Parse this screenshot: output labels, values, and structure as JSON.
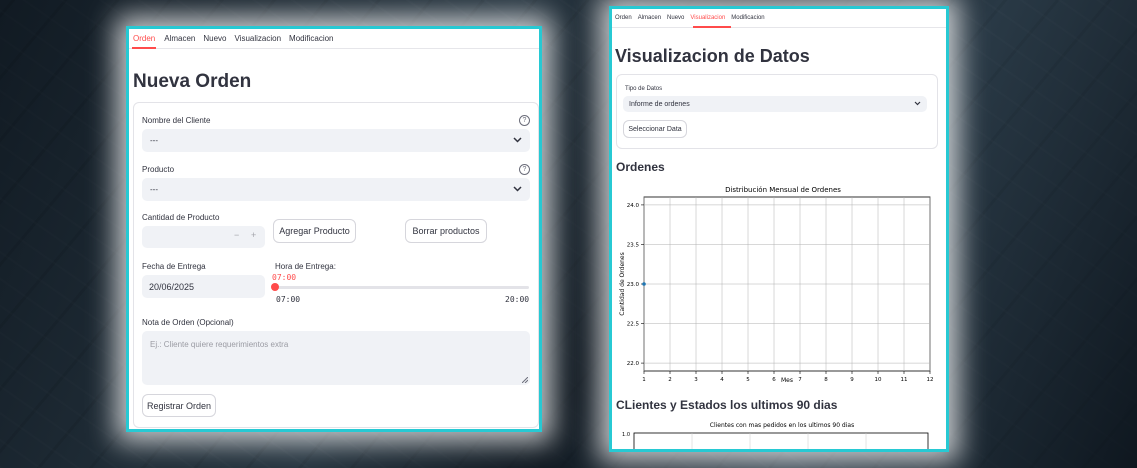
{
  "left": {
    "tabs": [
      "Orden",
      "Almacen",
      "Nuevo",
      "Visualizacion",
      "Modificacion"
    ],
    "active_tab": "Orden",
    "title": "Nueva Orden",
    "cliente": {
      "label": "Nombre del Cliente",
      "value": "---",
      "help_icon": "?"
    },
    "producto": {
      "label": "Producto",
      "value": "---",
      "help_icon": "?"
    },
    "cantidad": {
      "label": "Cantidad de Producto",
      "minus": "−",
      "plus": "+"
    },
    "agregar_button": "Agregar Producto",
    "borrar_button": "Borrar productos",
    "fecha": {
      "label": "Fecha de Entrega",
      "value": "20/06/2025"
    },
    "hora": {
      "label": "Hora de Entrega:",
      "current": "07:00",
      "min": "07:00",
      "max": "20:00",
      "fraction": 0
    },
    "nota": {
      "label": "Nota de Orden (Opcional)",
      "placeholder": "Ej.: Cliente quiere requerimientos extra"
    },
    "registrar_button": "Registrar Orden"
  },
  "right": {
    "tabs": [
      "Orden",
      "Almacen",
      "Nuevo",
      "Visualizacion",
      "Modificacion"
    ],
    "active_tab": "Visualizacion",
    "title": "Visualizacion de Datos",
    "tipo": {
      "label": "Tipo de Datos",
      "value": "Informe de ordenes"
    },
    "seleccionar_button": "Seleccionar Data",
    "ordenes_heading": "Ordenes",
    "clientes_heading": "CLientes y Estados los ultimos 90 dias",
    "chart2": {
      "title": "Clientes con mas pedidos en los ultimos 90 dias",
      "ytick": "1.0"
    }
  },
  "colors": {
    "accent": "#ff4b4b",
    "frame": "#27c9d3",
    "input_bg": "#f0f2f6",
    "text": "#31333f",
    "point": "#1f77b4"
  },
  "chart_data": {
    "type": "line",
    "title": "Distribución Mensual de Ordenes",
    "xlabel": "Mes",
    "ylabel": "Cantidad de Ordenes",
    "xlim": [
      1,
      12
    ],
    "ylim": [
      21.9,
      24.1
    ],
    "x_ticks": [
      "1",
      "2",
      "3",
      "4",
      "5",
      "6",
      "7",
      "8",
      "9",
      "10",
      "11",
      "12"
    ],
    "y_ticks": [
      "22.0",
      "22.5",
      "23.0",
      "23.5",
      "24.0"
    ],
    "grid": true,
    "series": [
      {
        "x": [
          1
        ],
        "values": [
          23.0
        ]
      }
    ]
  }
}
